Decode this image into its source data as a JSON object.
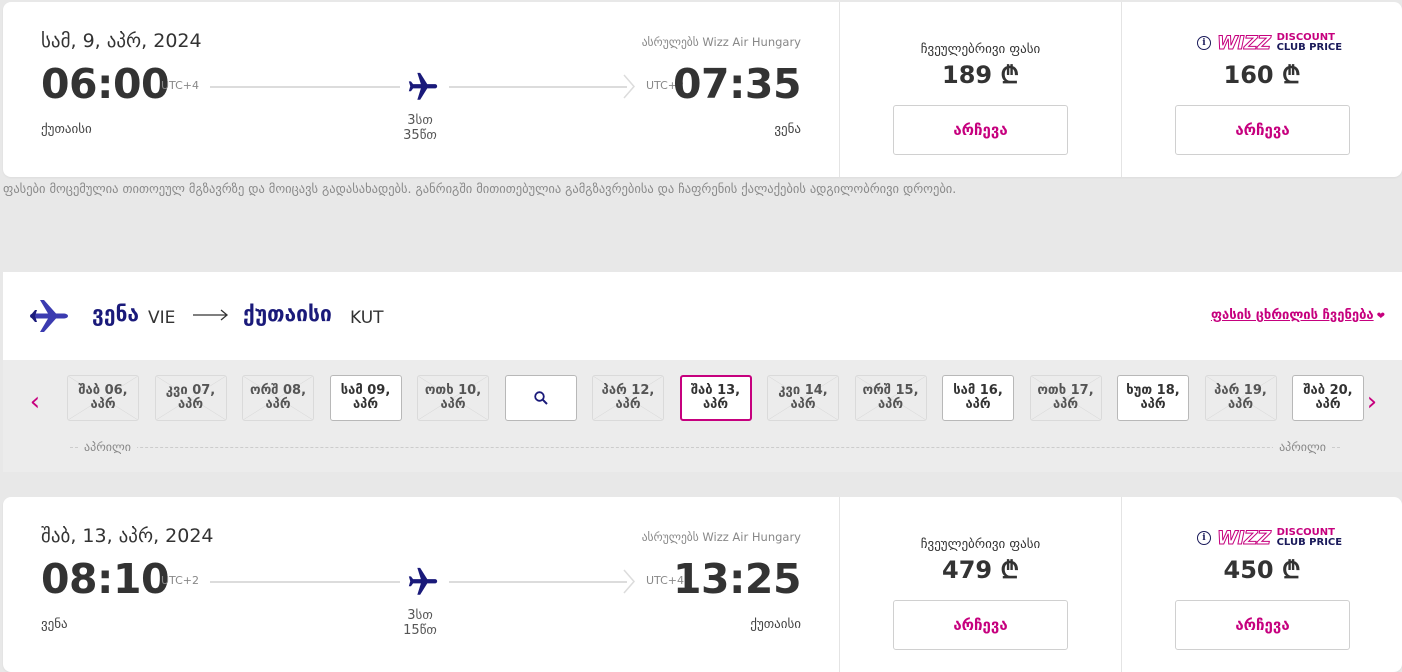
{
  "outbound": {
    "date": "სამ, 9, აპრ, 2024",
    "operated_by": "ასრულებს Wizz Air Hungary",
    "departure": {
      "time": "06:00",
      "utc": "UTC+4",
      "city": "ქუთაისი"
    },
    "arrival": {
      "time": "07:35",
      "utc": "UTC+2",
      "city": "ვენა"
    },
    "duration": "3სთ 35წთ",
    "regular_price": {
      "label": "ჩვეულებრივი ფასი",
      "value": "189 ₾",
      "button": "არჩევა"
    },
    "club_price": {
      "wizz_logo": "WIZZ",
      "discount": "DISCOUNT",
      "club_price": "CLUB PRICE",
      "info_icon": "i",
      "value": "160 ₾",
      "button": "არჩევა"
    }
  },
  "disclaimer": "ფასები მოცემულია თითოეულ მგზავრზე და მოიცავს გადასახადებს. განრიგში მითითებულია გამგზავრებისა და ჩაფრენის ქალაქების ადგილობრივი დროები.",
  "route": {
    "from_city": "ვენა",
    "from_code": "VIE",
    "to_city": "ქუთაისი",
    "to_code": "KUT",
    "price_table_link": "ფასის ცხრილის ჩვენება",
    "heart": "❤"
  },
  "date_strip": {
    "prev": "‹",
    "next": "›",
    "dates": [
      {
        "line1": "შაბ 06,",
        "line2": "აპრ",
        "state": "disabled"
      },
      {
        "line1": "კვი 07,",
        "line2": "აპრ",
        "state": "disabled"
      },
      {
        "line1": "ორშ 08,",
        "line2": "აპრ",
        "state": "disabled"
      },
      {
        "line1": "სამ 09,",
        "line2": "აპრ",
        "state": "available"
      },
      {
        "line1": "ოთხ 10,",
        "line2": "აპრ",
        "state": "disabled"
      },
      {
        "line1": "",
        "line2": "",
        "state": "search"
      },
      {
        "line1": "პარ 12,",
        "line2": "აპრ",
        "state": "disabled"
      },
      {
        "line1": "შაბ 13,",
        "line2": "აპრ",
        "state": "selected"
      },
      {
        "line1": "კვი 14,",
        "line2": "აპრ",
        "state": "disabled"
      },
      {
        "line1": "ორშ 15,",
        "line2": "აპრ",
        "state": "disabled"
      },
      {
        "line1": "სამ 16,",
        "line2": "აპრ",
        "state": "available"
      },
      {
        "line1": "ოთხ 17,",
        "line2": "აპრ",
        "state": "disabled"
      },
      {
        "line1": "ხუთ 18,",
        "line2": "აპრ",
        "state": "available"
      },
      {
        "line1": "პარ 19,",
        "line2": "აპრ",
        "state": "disabled"
      },
      {
        "line1": "შაბ 20,",
        "line2": "აპრ",
        "state": "available"
      }
    ],
    "month_left": "აპრილი",
    "month_right": "აპრილი"
  },
  "return": {
    "date": "შაბ, 13, აპრ, 2024",
    "operated_by": "ასრულებს Wizz Air Hungary",
    "departure": {
      "time": "08:10",
      "utc": "UTC+2",
      "city": "ვენა"
    },
    "arrival": {
      "time": "13:25",
      "utc": "UTC+4",
      "city": "ქუთაისი"
    },
    "duration": "3სთ 15წთ",
    "regular_price": {
      "label": "ჩვეულებრივი ფასი",
      "value": "479 ₾",
      "button": "არჩევა"
    },
    "club_price": {
      "wizz_logo": "WIZZ",
      "discount": "DISCOUNT",
      "club_price": "CLUB PRICE",
      "info_icon": "i",
      "value": "450 ₾",
      "button": "არჩევა"
    }
  },
  "colors": {
    "brand_magenta": "#c6007e",
    "brand_navy": "#1a1a7a"
  },
  "icons": [
    "airplane-icon",
    "info-icon",
    "search-icon",
    "chevron-left-icon",
    "chevron-right-icon",
    "heart-icon",
    "long-arrow-icon"
  ]
}
